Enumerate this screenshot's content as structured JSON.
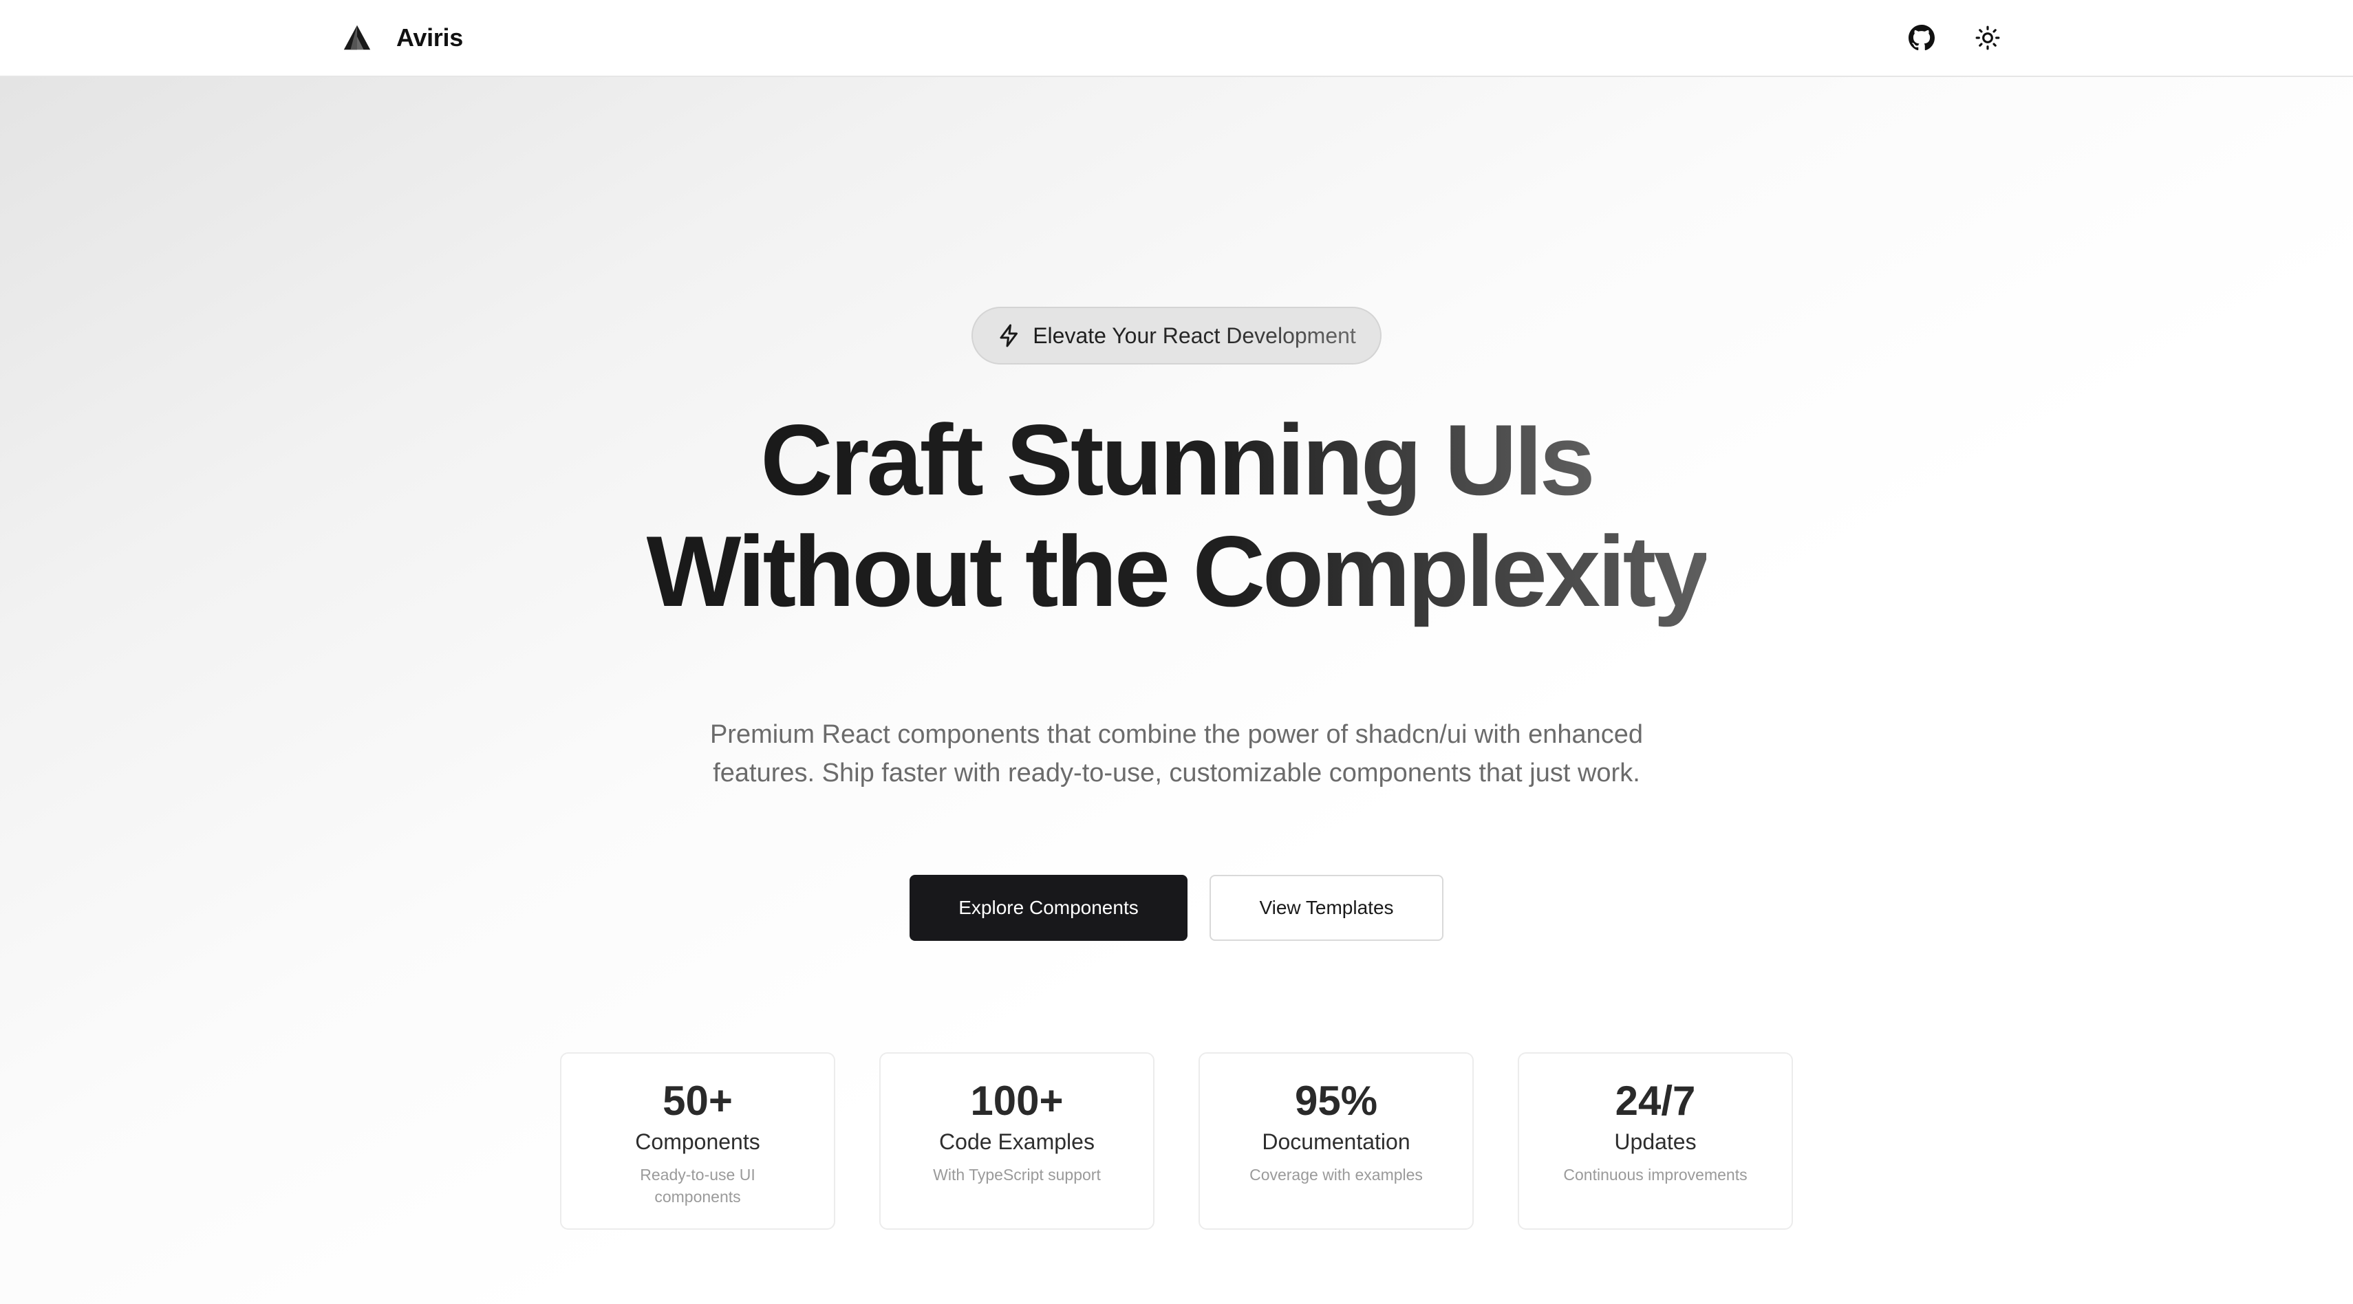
{
  "nav": {
    "brand_name": "Aviris",
    "logo_icon": "aviris-logo-icon",
    "github_icon": "github-icon",
    "theme_icon": "sun-icon"
  },
  "hero": {
    "badge_icon": "lightning-icon",
    "badge_text": "Elevate Your React Development",
    "headline_line1": "Craft Stunning UIs",
    "headline_line2": "Without the Complexity",
    "subtitle": "Premium React components that combine the power of shadcn/ui with enhanced features. Ship faster with ready-to-use, customizable components that just work.",
    "primary_cta": "Explore Components",
    "secondary_cta": "View Templates"
  },
  "stats": [
    {
      "value": "50+",
      "label": "Components",
      "description": "Ready-to-use UI components"
    },
    {
      "value": "100+",
      "label": "Code Examples",
      "description": "With TypeScript support"
    },
    {
      "value": "95%",
      "label": "Documentation",
      "description": "Coverage with examples"
    },
    {
      "value": "24/7",
      "label": "Updates",
      "description": "Continuous improvements"
    }
  ],
  "colors": {
    "primary_button_bg": "#18181b",
    "text_dark": "#1a1a1a",
    "text_muted": "#6b6b6b",
    "border": "#e6e6e6"
  }
}
